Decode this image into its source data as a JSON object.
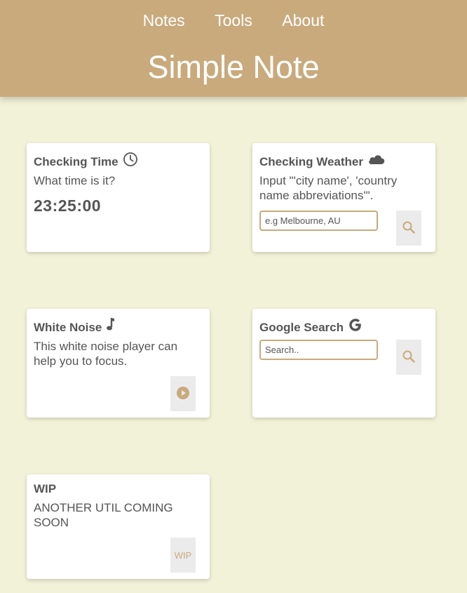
{
  "nav": {
    "items": [
      "Notes",
      "Tools",
      "About"
    ]
  },
  "brand": {
    "title": "Simple Note"
  },
  "cards": {
    "time": {
      "title": "Checking Time",
      "text": "What time is it?",
      "value": "23:25:00",
      "icon": "clock-icon"
    },
    "weather": {
      "title": "Checking Weather",
      "text": "Input \"'city name', 'country name abbreviations'\".",
      "placeholder": "e.g Melbourne, AU",
      "icon": "cloud-icon",
      "button_icon": "search-icon"
    },
    "noise": {
      "title": "White Noise",
      "text": "This white noise player can help you to focus.",
      "icon": "music-note-icon",
      "button_icon": "play-icon"
    },
    "google": {
      "title": "Google Search",
      "placeholder": "Search..",
      "icon": "google-g-icon",
      "button_icon": "search-icon"
    },
    "wip": {
      "title": "WIP",
      "text": "ANOTHER UTIL COMING SOON",
      "button_label": "WIP"
    }
  },
  "colors": {
    "header": "#c9aa7c",
    "background": "#f2f2d8",
    "card": "#ffffff",
    "accent": "#c9aa7c",
    "text": "#555555"
  }
}
